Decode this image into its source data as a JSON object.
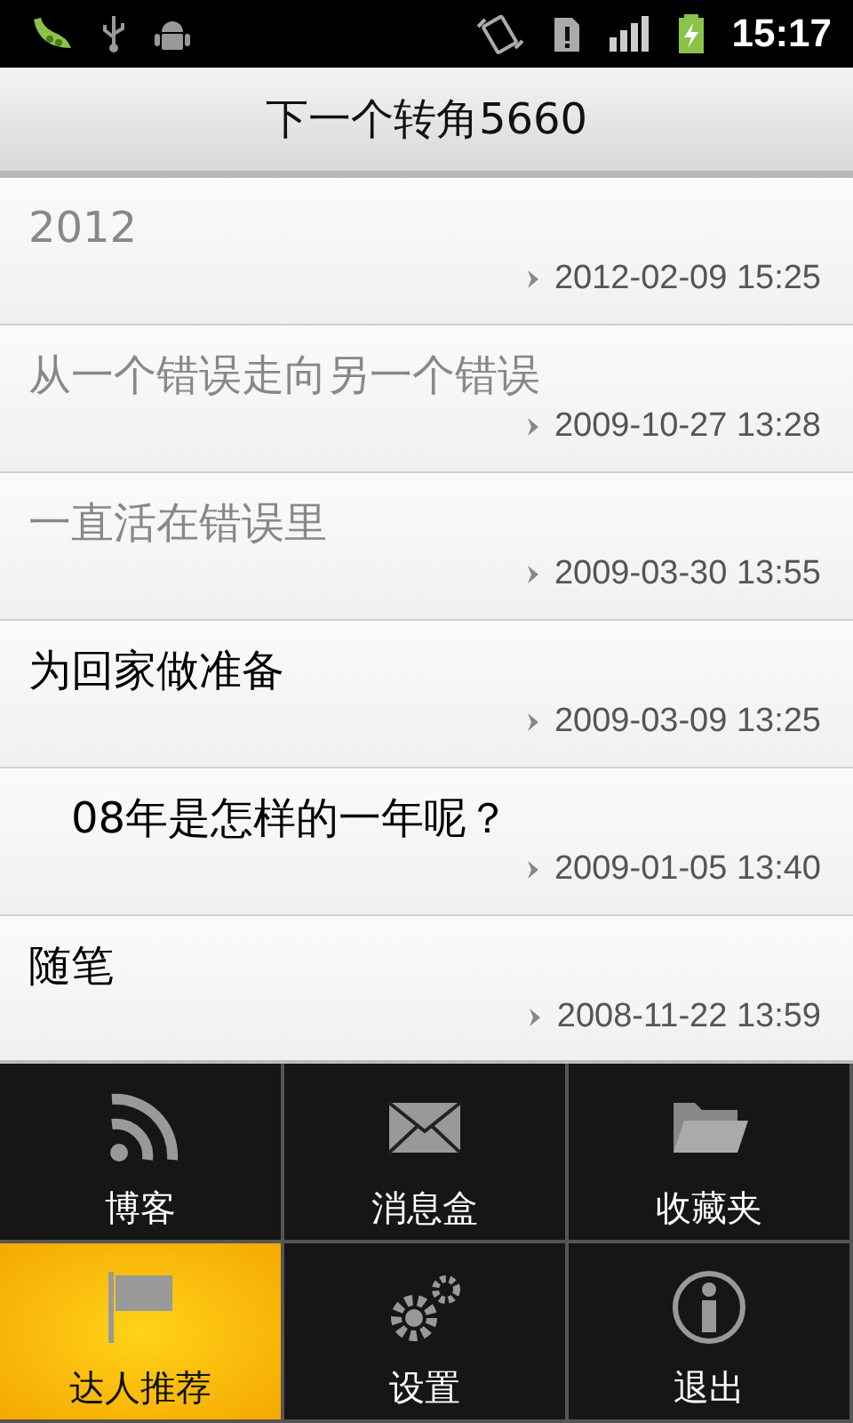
{
  "status_bar": {
    "time": "15:17"
  },
  "title": "下一个转角5660",
  "posts": [
    {
      "title": "2012",
      "date": "2012-02-09 15:25",
      "read": true
    },
    {
      "title": "从一个错误走向另一个错误",
      "date": "2009-10-27 13:28",
      "read": true
    },
    {
      "title": "一直活在错误里",
      "date": "2009-03-30 13:55",
      "read": true
    },
    {
      "title": "为回家做准备",
      "date": "2009-03-09 13:25",
      "read": false
    },
    {
      "title": "　08年是怎样的一年呢？",
      "date": "2009-01-05 13:40",
      "read": false
    },
    {
      "title": "随笔",
      "date": "2008-11-22 13:59",
      "read": false
    }
  ],
  "menu": [
    {
      "label": "博客",
      "selected": false
    },
    {
      "label": "消息盒",
      "selected": false
    },
    {
      "label": "收藏夹",
      "selected": false
    },
    {
      "label": "达人推荐",
      "selected": true
    },
    {
      "label": "设置",
      "selected": false
    },
    {
      "label": "退出",
      "selected": false
    }
  ]
}
